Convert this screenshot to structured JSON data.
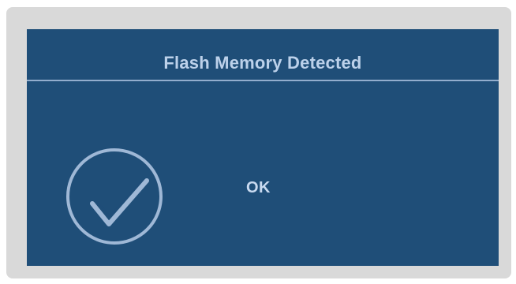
{
  "dialog": {
    "title": "Flash Memory Detected",
    "status_text": "OK",
    "icon": "checkmark-circle-icon"
  },
  "colors": {
    "frame": "#d9d9d9",
    "panel": "#1f4e78",
    "text": "#c9daf0",
    "accent": "#9fb8d6"
  }
}
